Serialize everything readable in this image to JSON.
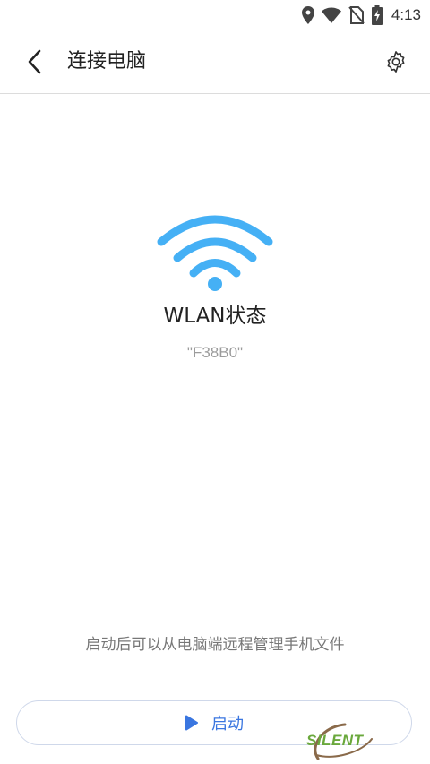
{
  "status_bar": {
    "time": "4:13",
    "icons": [
      "location-icon",
      "wifi-signal-icon",
      "no-sim-icon",
      "battery-charging-icon"
    ]
  },
  "app_bar": {
    "title": "连接电脑",
    "back_icon": "chevron-left-icon",
    "settings_icon": "gear-icon"
  },
  "main": {
    "wifi_icon": "wifi-icon",
    "status_title": "WLAN状态",
    "ssid": "\"F38B0\""
  },
  "footer": {
    "hint": "启动后可以从电脑端远程管理手机文件",
    "start_label": "启动",
    "start_icon": "play-icon"
  },
  "watermark": {
    "text": "SILENT"
  },
  "colors": {
    "accent_blue": "#3a76e0",
    "wifi_blue": "#45b0f5",
    "text_primary": "#222222",
    "text_secondary": "#9b9b9b"
  }
}
